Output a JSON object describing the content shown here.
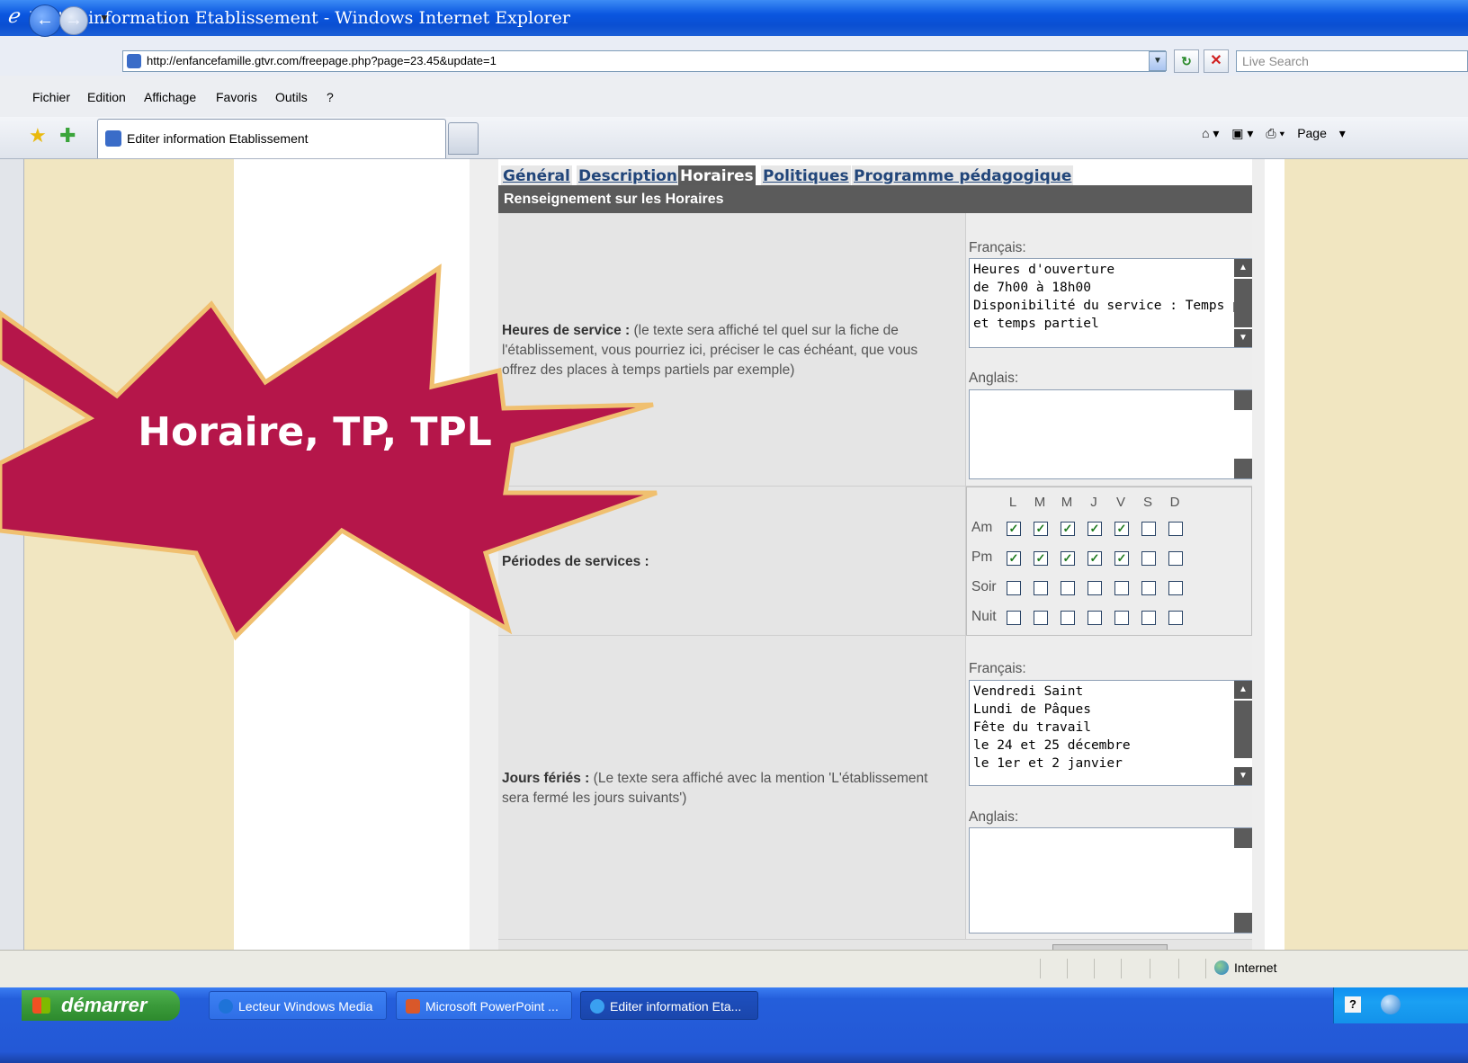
{
  "window": {
    "title": "Editer information Etablissement - Windows Internet Explorer"
  },
  "browser": {
    "url": "http://enfancefamille.gtvr.com/freepage.php?page=23.45&update=1",
    "search_placeholder": "Live Search",
    "menu": [
      "Fichier",
      "Edition",
      "Affichage",
      "Favoris",
      "Outils",
      "?"
    ],
    "tab_title": "Editer information Etablissement",
    "page_menu_label": "Page"
  },
  "form": {
    "tabs": [
      "Général",
      "Description",
      "Horaires",
      "Politiques",
      "Programme pédagogique"
    ],
    "active_tab": "Horaires",
    "section_title": "Renseignement sur les Horaires",
    "heures": {
      "label_bold": "Heures de service :",
      "label_rest": " (le texte sera affiché tel quel sur la fiche de l'établissement, vous pourriez ici, préciser le cas échéant, que vous offrez des places à temps partiels par exemple)",
      "fr_label": "Français:",
      "fr_value": "Heures d'ouverture\nde 7h00 à 18h00\nDisponibilité du service : Temps plein\net temps partiel",
      "en_label": "Anglais:",
      "en_value": ""
    },
    "periodes": {
      "label_bold": "Périodes de services :",
      "days": [
        "L",
        "M",
        "M",
        "J",
        "V",
        "S",
        "D"
      ],
      "rows": [
        {
          "label": "Am",
          "checked": [
            true,
            true,
            true,
            true,
            true,
            false,
            false
          ]
        },
        {
          "label": "Pm",
          "checked": [
            true,
            true,
            true,
            true,
            true,
            false,
            false
          ]
        },
        {
          "label": "Soir",
          "checked": [
            false,
            false,
            false,
            false,
            false,
            false,
            false
          ]
        },
        {
          "label": "Nuit",
          "checked": [
            false,
            false,
            false,
            false,
            false,
            false,
            false
          ]
        }
      ]
    },
    "feries": {
      "label_bold": "Jours fériés :",
      "label_rest": " (Le texte sera affiché avec la mention 'L'établissement sera fermé les jours suivants')",
      "fr_label": "Français:",
      "fr_value": "Vendredi Saint\nLundi de Pâques\nFête du travail\nle 24 et 25 décembre\nle 1er et 2 janvier",
      "en_label": "Anglais:",
      "en_value": ""
    }
  },
  "callout": {
    "text": "Horaire, TP, TPL",
    "color": "#b5164a",
    "border": "#f0c070"
  },
  "statusbar": {
    "zone": "Internet"
  },
  "taskbar": {
    "start_label": "démarrer",
    "tasks": [
      {
        "label": "Lecteur Windows Media",
        "icon": "media-player-icon",
        "active": false
      },
      {
        "label": "Microsoft PowerPoint ...",
        "icon": "powerpoint-icon",
        "active": false
      },
      {
        "label": "Editer information Eta...",
        "icon": "ie-icon",
        "active": true
      }
    ]
  }
}
